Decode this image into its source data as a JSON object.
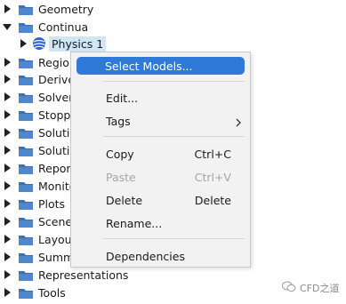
{
  "tree": {
    "items": [
      {
        "label": "Geometry",
        "expanded": false
      },
      {
        "label": "Continua",
        "expanded": true
      },
      {
        "label": "Physics 1",
        "expanded": false,
        "selected": true
      },
      {
        "label": "Regions",
        "expanded": false
      },
      {
        "label": "Derived Parts",
        "expanded": false
      },
      {
        "label": "Solvers",
        "expanded": false
      },
      {
        "label": "Stopping Criteria",
        "expanded": false
      },
      {
        "label": "Solution Views",
        "expanded": false
      },
      {
        "label": "Solution Histories",
        "expanded": false
      },
      {
        "label": "Reports",
        "expanded": false
      },
      {
        "label": "Monitors",
        "expanded": false
      },
      {
        "label": "Plots",
        "expanded": false
      },
      {
        "label": "Scenes",
        "expanded": false
      },
      {
        "label": "Layouts",
        "expanded": false
      },
      {
        "label": "Summaries",
        "expanded": false
      },
      {
        "label": "Representations",
        "expanded": false
      },
      {
        "label": "Tools",
        "expanded": false
      }
    ]
  },
  "context_menu": {
    "select_models": "Select Models...",
    "edit": "Edit...",
    "tags": "Tags",
    "copy": "Copy",
    "copy_shortcut": "Ctrl+C",
    "paste": "Paste",
    "paste_shortcut": "Ctrl+V",
    "delete": "Delete",
    "delete_shortcut": "Delete",
    "rename": "Rename...",
    "dependencies": "Dependencies"
  },
  "watermark": {
    "text": "CFD之道"
  },
  "colors": {
    "highlight": "#2f7ad7",
    "selection": "#cfe6f6",
    "folder": "#3d6fb3",
    "physics": "#2a63c9"
  },
  "icons": {
    "folder": "folder-icon",
    "physics": "physics-continuum-icon",
    "collapsed": "triangle-right-icon",
    "expanded": "triangle-down-icon",
    "submenu": "chevron-right-icon"
  }
}
